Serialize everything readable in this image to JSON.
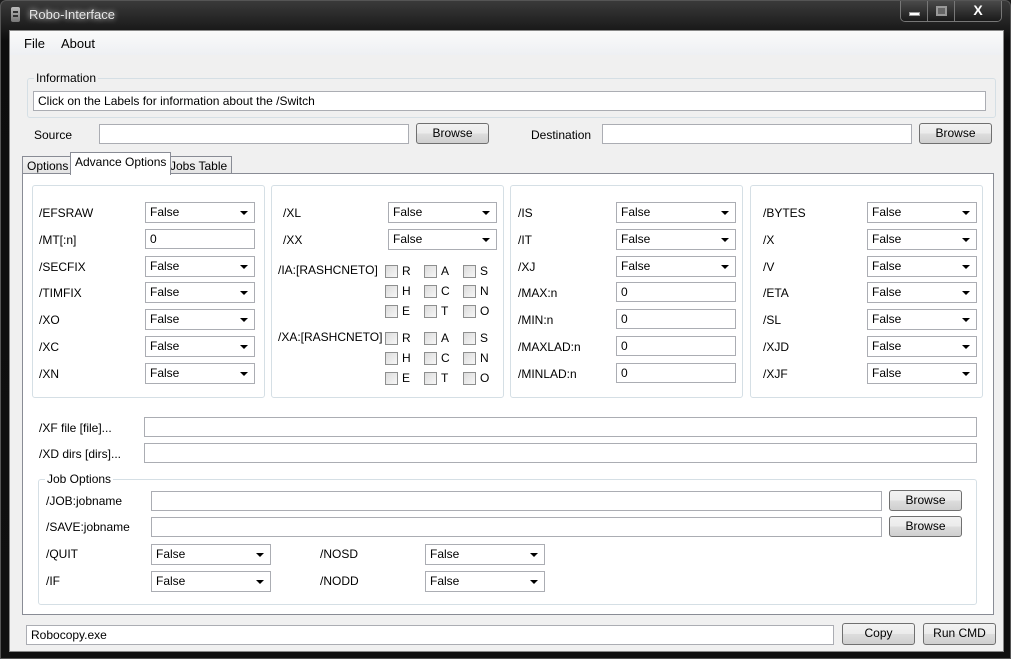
{
  "window": {
    "title": "Robo-Interface",
    "close_glyph": "X"
  },
  "menu": [
    "File",
    "About"
  ],
  "information": {
    "group_label": "Information",
    "text": "Click on the Labels for information about the /Switch"
  },
  "source": {
    "label": "Source",
    "value": "",
    "browse_label": "Browse"
  },
  "destination": {
    "label": "Destination",
    "value": "",
    "browse_label": "Browse"
  },
  "tabs": [
    {
      "label": "Options",
      "active": false
    },
    {
      "label": "Advance Options",
      "active": true
    },
    {
      "label": "Jobs Table",
      "active": false
    }
  ],
  "group1": [
    {
      "label": "/EFSRAW",
      "type": "combo",
      "value": "False"
    },
    {
      "label": "/MT[:n]",
      "type": "text",
      "value": "0"
    },
    {
      "label": "/SECFIX",
      "type": "combo",
      "value": "False"
    },
    {
      "label": "/TIMFIX",
      "type": "combo",
      "value": "False"
    },
    {
      "label": "/XO",
      "type": "combo",
      "value": "False"
    },
    {
      "label": "/XC",
      "type": "combo",
      "value": "False"
    },
    {
      "label": "/XN",
      "type": "combo",
      "value": "False"
    }
  ],
  "group2": {
    "combos": [
      {
        "label": "/XL",
        "value": "False"
      },
      {
        "label": "/XX",
        "value": "False"
      }
    ],
    "ia": {
      "label": "/IA:[RASHCNETO]",
      "checks": [
        {
          "letter": "R",
          "checked": false
        },
        {
          "letter": "A",
          "checked": false
        },
        {
          "letter": "S",
          "checked": false
        },
        {
          "letter": "H",
          "checked": false
        },
        {
          "letter": "C",
          "checked": false
        },
        {
          "letter": "N",
          "checked": false
        },
        {
          "letter": "E",
          "checked": false
        },
        {
          "letter": "T",
          "checked": false
        },
        {
          "letter": "O",
          "checked": false
        }
      ]
    },
    "xa": {
      "label": "/XA:[RASHCNETO]",
      "checks": [
        {
          "letter": "R",
          "checked": false
        },
        {
          "letter": "A",
          "checked": false
        },
        {
          "letter": "S",
          "checked": false
        },
        {
          "letter": "H",
          "checked": false
        },
        {
          "letter": "C",
          "checked": false
        },
        {
          "letter": "N",
          "checked": false
        },
        {
          "letter": "E",
          "checked": false
        },
        {
          "letter": "T",
          "checked": false
        },
        {
          "letter": "O",
          "checked": false
        }
      ]
    }
  },
  "group3": [
    {
      "label": "/IS",
      "type": "combo",
      "value": "False"
    },
    {
      "label": "/IT",
      "type": "combo",
      "value": "False"
    },
    {
      "label": "/XJ",
      "type": "combo",
      "value": "False"
    },
    {
      "label": "/MAX:n",
      "type": "text",
      "value": "0"
    },
    {
      "label": "/MIN:n",
      "type": "text",
      "value": "0"
    },
    {
      "label": "/MAXLAD:n",
      "type": "text",
      "value": "0"
    },
    {
      "label": "/MINLAD:n",
      "type": "text",
      "value": "0"
    }
  ],
  "group4": [
    {
      "label": "/BYTES",
      "type": "combo",
      "value": "False"
    },
    {
      "label": "/X",
      "type": "combo",
      "value": "False"
    },
    {
      "label": "/V",
      "type": "combo",
      "value": "False"
    },
    {
      "label": "/ETA",
      "type": "combo",
      "value": "False"
    },
    {
      "label": "/SL",
      "type": "combo",
      "value": "False"
    },
    {
      "label": "/XJD",
      "type": "combo",
      "value": "False"
    },
    {
      "label": "/XJF",
      "type": "combo",
      "value": "False"
    }
  ],
  "xf": {
    "label": "/XF file [file]...",
    "value": ""
  },
  "xd": {
    "label": "/XD dirs [dirs]...",
    "value": ""
  },
  "job_options": {
    "group_label": "Job Options",
    "job": {
      "label": "/JOB:jobname",
      "value": "",
      "browse_label": "Browse"
    },
    "save": {
      "label": "/SAVE:jobname",
      "value": "",
      "browse_label": "Browse"
    },
    "quit": {
      "label": "/QUIT",
      "value": "False"
    },
    "if": {
      "label": "/IF",
      "value": "False"
    },
    "nosd": {
      "label": "/NOSD",
      "value": "False"
    },
    "nodd": {
      "label": "/NODD",
      "value": "False"
    }
  },
  "command": {
    "value": "Robocopy.exe",
    "copy_label": "Copy",
    "run_label": "Run CMD"
  }
}
